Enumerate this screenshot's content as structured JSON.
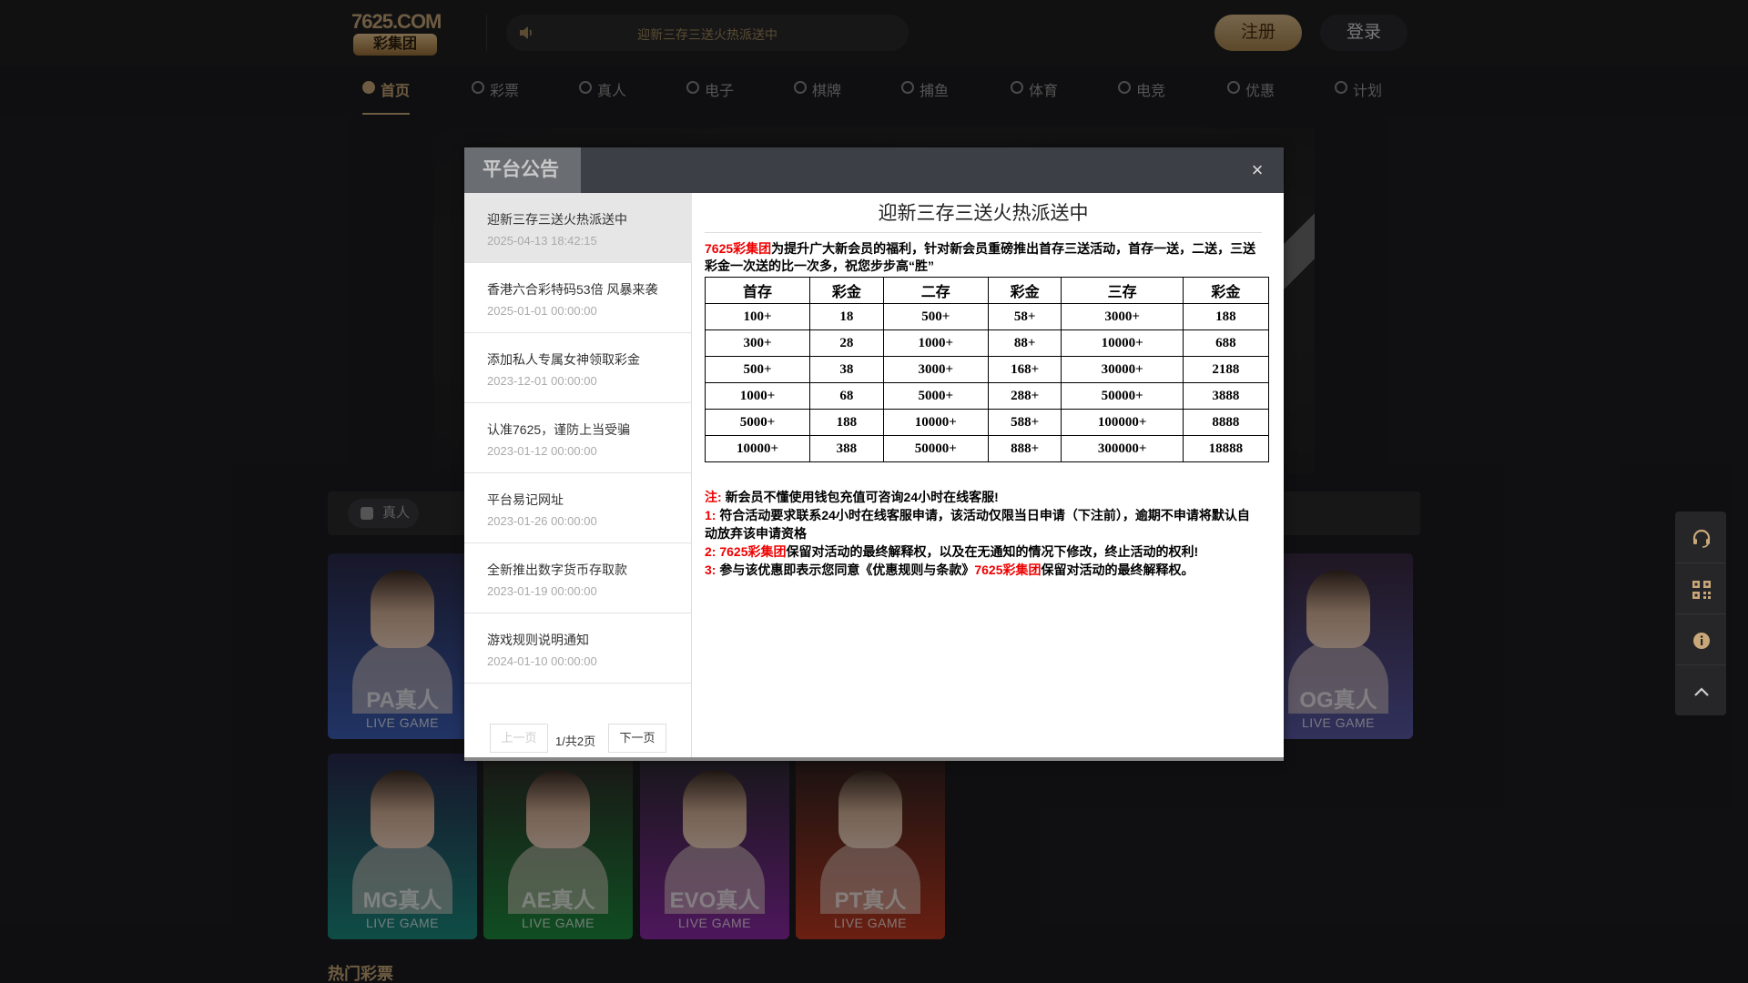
{
  "header": {
    "logo_top": "7625.COM",
    "logo_bottom": "彩集团",
    "marquee": "迎新三存三送火热派送中",
    "register": "注册",
    "login": "登录"
  },
  "nav": [
    {
      "label": "首页",
      "icon": "home-icon",
      "active": true
    },
    {
      "label": "彩票",
      "icon": "lottery-icon"
    },
    {
      "label": "真人",
      "icon": "live-icon"
    },
    {
      "label": "电子",
      "icon": "slot-icon"
    },
    {
      "label": "棋牌",
      "icon": "cards-icon"
    },
    {
      "label": "捕鱼",
      "icon": "fish-icon"
    },
    {
      "label": "体育",
      "icon": "sports-icon"
    },
    {
      "label": "电竞",
      "icon": "gamepad-icon"
    },
    {
      "label": "优惠",
      "icon": "gift-icon"
    },
    {
      "label": "计划",
      "icon": "headset-icon"
    }
  ],
  "category": {
    "label": "真人"
  },
  "cards": [
    {
      "title": "PA真人",
      "sub": "LIVE GAME",
      "color": "#3d5fb8"
    },
    {
      "title": "OG真人",
      "sub": "LIVE GAME",
      "color": "#5a5aa8"
    },
    {
      "title": "MG真人",
      "sub": "LIVE GAME",
      "color": "#1c8c80"
    },
    {
      "title": "AE真人",
      "sub": "LIVE GAME",
      "color": "#1e8e3e"
    },
    {
      "title": "EVO真人",
      "sub": "LIVE GAME",
      "color": "#8e2aa8"
    },
    {
      "title": "PT真人",
      "sub": "LIVE GAME",
      "color": "#c23a22"
    }
  ],
  "hot_title": "热门彩票",
  "modal": {
    "tab": "平台公告",
    "close": "×",
    "items": [
      {
        "title": "迎新三存三送火热派送中",
        "date": "2025-04-13 18:42:15"
      },
      {
        "title": "香港六合彩特码53倍 风暴来袭",
        "date": "2025-01-01 00:00:00"
      },
      {
        "title": "添加私人专属女神领取彩金",
        "date": "2023-12-01 00:00:00"
      },
      {
        "title": "认准7625，谨防上当受骗",
        "date": "2023-01-12 00:00:00"
      },
      {
        "title": "平台易记网址",
        "date": "2023-01-26 00:00:00"
      },
      {
        "title": "全新推出数字货币存取款",
        "date": "2023-01-19 00:00:00"
      },
      {
        "title": "游戏规则说明通知",
        "date": "2024-01-10 00:00:00"
      }
    ],
    "pager": {
      "prev": "上一页",
      "info": "1/共2页",
      "next": "下一页"
    },
    "content": {
      "title": "迎新三存三送火热派送中",
      "brand": "7625彩集团",
      "intro": "为提升广大新会员的福利，针对新会员重磅推出首存三送活动，首存一送，二送，三送彩金一次送的比一次多，祝您步步高“胜”",
      "table_head": [
        "首存",
        "彩金",
        "二存",
        "彩金",
        "三存",
        "彩金"
      ],
      "table_rows": [
        [
          "100+",
          "18",
          "500+",
          "58+",
          "3000+",
          "188"
        ],
        [
          "300+",
          "28",
          "1000+",
          "88+",
          "10000+",
          "688"
        ],
        [
          "500+",
          "38",
          "3000+",
          "168+",
          "30000+",
          "2188"
        ],
        [
          "1000+",
          "68",
          "5000+",
          "288+",
          "50000+",
          "3888"
        ],
        [
          "5000+",
          "188",
          "10000+",
          "588+",
          "100000+",
          "8888"
        ],
        [
          "10000+",
          "388",
          "50000+",
          "888+",
          "300000+",
          "18888"
        ]
      ],
      "note_label": "注:",
      "note": "新会员不懂使用钱包充值可咨询24小时在线客服!",
      "rule1_label": "1:",
      "rule1": "符合活动要求联系24小时在线客服申请，该活动仅限当日申请（下注前），逾期不申请将默认自动放弃该申请资格",
      "rule2_label": "2:",
      "rule2": "保留对活动的最终解释权，以及在无通知的情况下修改，终止活动的权利!",
      "rule3_label": "3:",
      "rule3_a": "参与该优惠即表示您同意《优惠规则与条款》",
      "rule3_b": "保留对活动的最终解释权。"
    }
  },
  "side": [
    "headset-icon",
    "qrcode-icon",
    "info-icon",
    "chevron-up-icon"
  ]
}
